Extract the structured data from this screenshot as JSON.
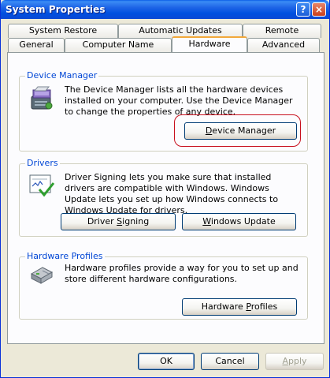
{
  "window": {
    "title": "System Properties",
    "help_glyph": "?",
    "close_glyph": "×"
  },
  "tabs": {
    "row1": [
      "System Restore",
      "Automatic Updates",
      "Remote"
    ],
    "row2": [
      "General",
      "Computer Name",
      "Hardware",
      "Advanced"
    ],
    "active": "Hardware"
  },
  "device_manager": {
    "label": "Device Manager",
    "text": "The Device Manager lists all the hardware devices installed on your computer. Use the Device Manager to change the properties of any device.",
    "button_pre": "",
    "button_ul": "D",
    "button_post": "evice Manager",
    "icon": "device-manager-icon"
  },
  "drivers": {
    "label": "Drivers",
    "text": "Driver Signing lets you make sure that installed drivers are compatible with Windows. Windows Update lets you set up how Windows connects to Windows Update for drivers.",
    "signing_pre": "Driver ",
    "signing_ul": "S",
    "signing_post": "igning",
    "update_pre": "",
    "update_ul": "W",
    "update_post": "indows Update",
    "icon": "driver-signing-icon"
  },
  "hardware_profiles": {
    "label": "Hardware Profiles",
    "text": "Hardware profiles provide a way for you to set up and store different hardware configurations.",
    "button_pre": "Hardware ",
    "button_ul": "P",
    "button_post": "rofiles",
    "icon": "hardware-profiles-icon"
  },
  "footer": {
    "ok": "OK",
    "cancel": "Cancel",
    "apply_pre": "",
    "apply_ul": "A",
    "apply_post": "pply"
  },
  "colors": {
    "title_bar": "#0a5ce6",
    "group_label": "#0046d5",
    "highlight": "#c8101e",
    "active_tab_accent": "#f2a83b"
  }
}
